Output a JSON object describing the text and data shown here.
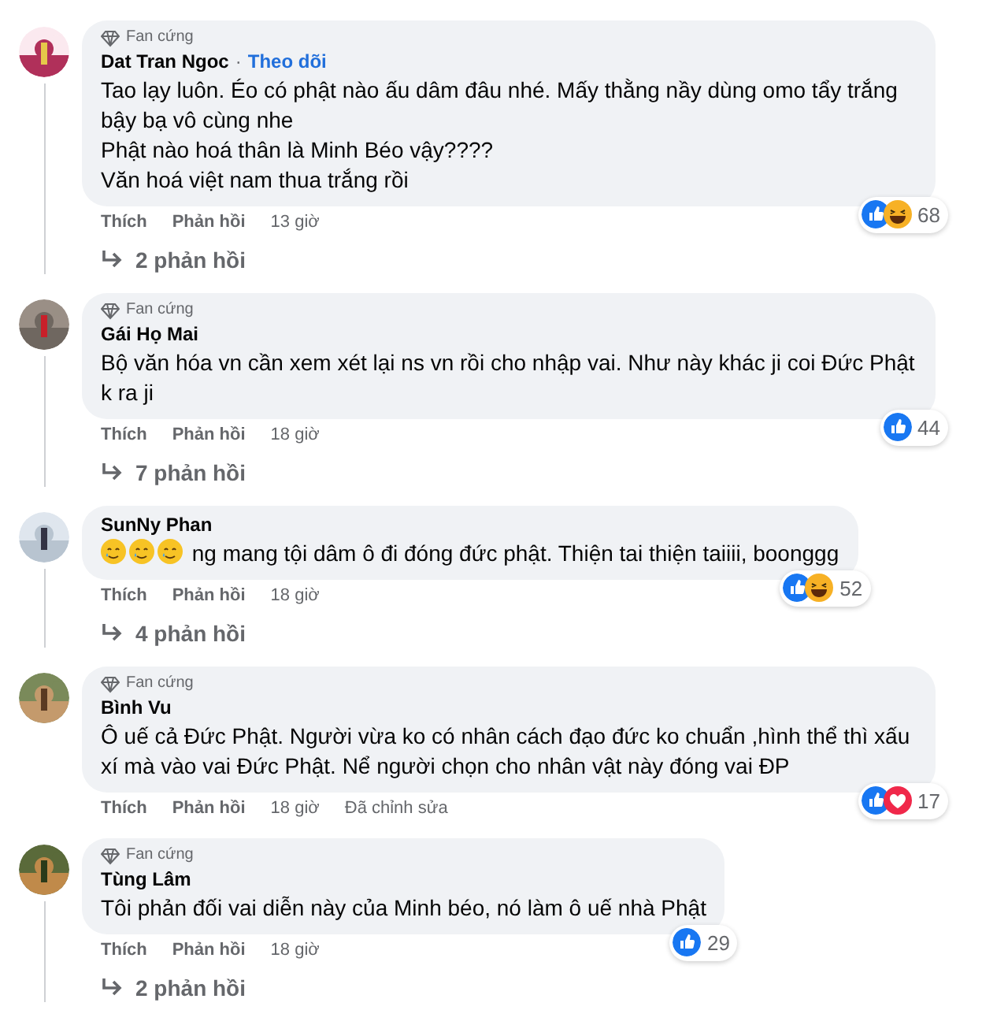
{
  "comments": [
    {
      "badge": "Fan cứng",
      "name": "Dat Tran Ngoc",
      "separator": "·",
      "follow": "Theo dõi",
      "text": "Tao lạy luôn. Éo có phật nào ấu dâm đâu nhé. Mấy thằng nầy dùng omo tẩy trắng bậy bạ vô cùng nhe\nPhật nào hoá thân là Minh Béo vậy????\nVăn hoá việt nam thua trắng rồi",
      "reactions": [
        {
          "kind": "like"
        },
        {
          "kind": "haha"
        }
      ],
      "reaction_count": "68",
      "like": "Thích",
      "reply": "Phản hồi",
      "time": "13 giờ",
      "replies": "2 phản hồi"
    },
    {
      "badge": "Fan cứng",
      "name": "Gái Họ Mai",
      "text": "Bộ văn hóa vn cần xem xét lại ns vn rồi cho nhập vai. Như này khác ji coi Đức Phật k ra ji",
      "reactions": [
        {
          "kind": "like"
        }
      ],
      "reaction_count": "44",
      "like": "Thích",
      "reply": "Phản hồi",
      "time": "18 giờ",
      "replies": "7 phản hồi"
    },
    {
      "name": "SunNy Phan",
      "emojis": [
        {
          "kind": "smile-tear"
        },
        {
          "kind": "smile-tear"
        },
        {
          "kind": "smile-tear"
        }
      ],
      "text": "ng mang tội dâm ô đi đóng đức phật. Thiện tai thiện taiiii, boonggg",
      "reactions": [
        {
          "kind": "like"
        },
        {
          "kind": "haha"
        }
      ],
      "reaction_count": "52",
      "like": "Thích",
      "reply": "Phản hồi",
      "time": "18 giờ",
      "replies": "4 phản hồi"
    },
    {
      "badge": "Fan cứng",
      "name": "Bình Vu",
      "text": "Ô uế cả Đức Phật. Người vừa ko có nhân cách đạo đức ko chuẩn ,hình thể thì xấu xí mà vào vai Đức Phật. Nể người chọn cho nhân vật này đóng vai ĐP",
      "reactions": [
        {
          "kind": "like"
        },
        {
          "kind": "love"
        }
      ],
      "reaction_count": "17",
      "like": "Thích",
      "reply": "Phản hồi",
      "time": "18 giờ",
      "edited": "Đã chỉnh sửa"
    },
    {
      "badge": "Fan cứng",
      "name": "Tùng Lâm",
      "text": "Tôi phản đối vai diễn này của Minh béo, nó làm ô uế nhà Phật",
      "reactions": [
        {
          "kind": "like"
        }
      ],
      "reaction_count": "29",
      "like": "Thích",
      "reply": "Phản hồi",
      "time": "18 giờ",
      "replies": "2 phản hồi"
    }
  ]
}
